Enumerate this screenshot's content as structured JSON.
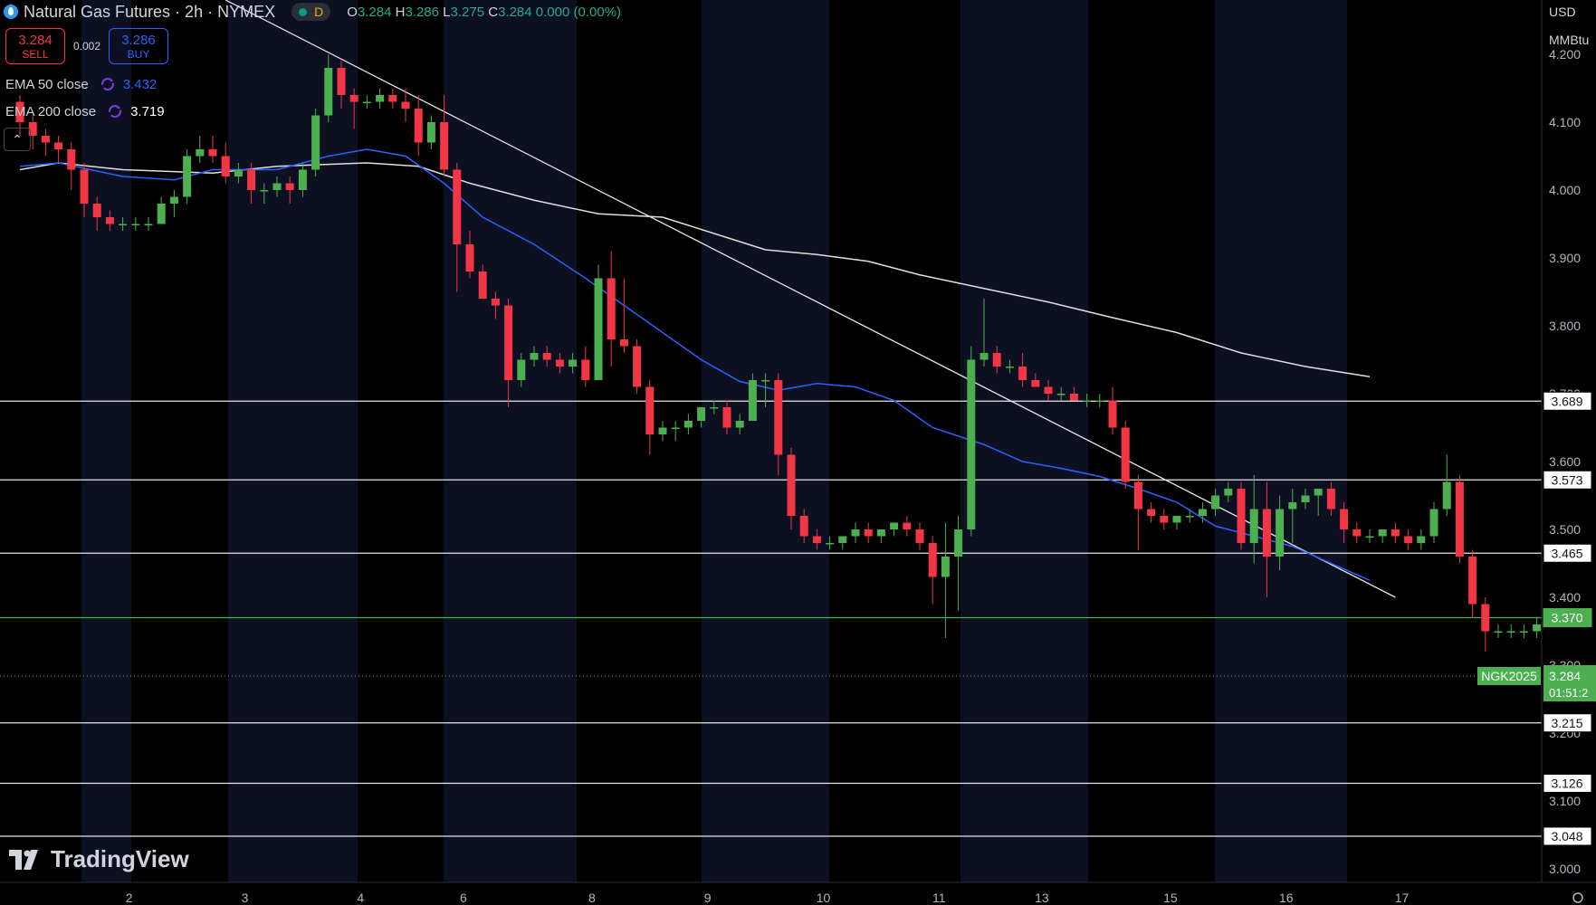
{
  "header": {
    "title": "Natural Gas Futures · 2h · NYMEX",
    "status_badge": "D",
    "ohlc": [
      {
        "label": "O",
        "value": "3.284"
      },
      {
        "label": "H",
        "value": "3.286"
      },
      {
        "label": "L",
        "value": "3.275"
      },
      {
        "label": "C",
        "value": "3.284"
      }
    ],
    "change": "0.000 (0.00%)"
  },
  "trade": {
    "sell_price": "3.284",
    "sell_label": "SELL",
    "spread": "0.002",
    "buy_price": "3.286",
    "buy_label": "BUY"
  },
  "indicators": [
    {
      "label": "EMA 50 close",
      "value": "3.432",
      "color": "#2962ff"
    },
    {
      "label": "EMA 200 close",
      "value": "3.719",
      "color": "#ffffff"
    }
  ],
  "collapse_icon": "chevron-up-icon",
  "logo": "TradingView",
  "axis_units": {
    "currency": "USD",
    "unit": "MMBtu"
  },
  "colors": {
    "up": "#4caf50",
    "down": "#f23645",
    "ema50": "#2962ff",
    "ema200": "#e0e0e0",
    "background": "#000000",
    "session": "#0c1020"
  },
  "chart_data": {
    "type": "candlestick",
    "symbol_tag": "NGK2025",
    "countdown": "01:51:2",
    "last_price": 3.284,
    "ylim": [
      2.98,
      4.28
    ],
    "y_ticks": [
      "4.200",
      "4.100",
      "4.000",
      "3.900",
      "3.800",
      "3.700",
      "3.600",
      "3.500",
      "3.400",
      "3.300",
      "3.200",
      "3.100",
      "3.000"
    ],
    "x_ticks": [
      {
        "label": "2",
        "bar": 8.5
      },
      {
        "label": "3",
        "bar": 17.5
      },
      {
        "label": "4",
        "bar": 26.5
      },
      {
        "label": "6",
        "bar": 34.5
      },
      {
        "label": "8",
        "bar": 44.5
      },
      {
        "label": "9",
        "bar": 53.5
      },
      {
        "label": "10",
        "bar": 62.5
      },
      {
        "label": "11",
        "bar": 71.5
      },
      {
        "label": "13",
        "bar": 79.5
      },
      {
        "label": "15",
        "bar": 89.5
      },
      {
        "label": "16",
        "bar": 98.5
      },
      {
        "label": "17",
        "bar": 107.5
      }
    ],
    "horizontal_levels": [
      {
        "value": 3.689,
        "label": "3.689",
        "style": "white"
      },
      {
        "value": 3.573,
        "label": "3.573",
        "style": "white"
      },
      {
        "value": 3.465,
        "label": "3.465",
        "style": "white"
      },
      {
        "value": 3.37,
        "label": "3.370",
        "style": "green"
      },
      {
        "value": 3.215,
        "label": "3.215",
        "style": "white"
      },
      {
        "value": 3.126,
        "label": "3.126",
        "style": "white"
      },
      {
        "value": 3.048,
        "label": "3.048",
        "style": "white"
      }
    ],
    "trendline": {
      "from": {
        "bar": 16,
        "price": 4.28
      },
      "to": {
        "bar": 107,
        "price": 3.4
      }
    },
    "ema200_points": [
      [
        0,
        4.03
      ],
      [
        3,
        4.04
      ],
      [
        8,
        4.03
      ],
      [
        15,
        4.025
      ],
      [
        20,
        4.035
      ],
      [
        27,
        4.04
      ],
      [
        31,
        4.035
      ],
      [
        35,
        4.01
      ],
      [
        40,
        3.985
      ],
      [
        45,
        3.965
      ],
      [
        50,
        3.96
      ],
      [
        55,
        3.93
      ],
      [
        58,
        3.912
      ],
      [
        62,
        3.905
      ],
      [
        66,
        3.895
      ],
      [
        70,
        3.875
      ],
      [
        75,
        3.855
      ],
      [
        80,
        3.835
      ],
      [
        85,
        3.812
      ],
      [
        90,
        3.79
      ],
      [
        95,
        3.76
      ],
      [
        100,
        3.74
      ],
      [
        105,
        3.725
      ]
    ],
    "ema50_points": [
      [
        0,
        4.035
      ],
      [
        3,
        4.04
      ],
      [
        8,
        4.02
      ],
      [
        12,
        4.015
      ],
      [
        15,
        4.03
      ],
      [
        20,
        4.03
      ],
      [
        24,
        4.05
      ],
      [
        27,
        4.06
      ],
      [
        30,
        4.05
      ],
      [
        33,
        4.01
      ],
      [
        36,
        3.96
      ],
      [
        40,
        3.92
      ],
      [
        44,
        3.87
      ],
      [
        47,
        3.83
      ],
      [
        50,
        3.79
      ],
      [
        53,
        3.75
      ],
      [
        56,
        3.718
      ],
      [
        59,
        3.705
      ],
      [
        62,
        3.715
      ],
      [
        65,
        3.71
      ],
      [
        68,
        3.69
      ],
      [
        71,
        3.65
      ],
      [
        75,
        3.625
      ],
      [
        78,
        3.6
      ],
      [
        81,
        3.59
      ],
      [
        84,
        3.578
      ],
      [
        87,
        3.56
      ],
      [
        90,
        3.54
      ],
      [
        93,
        3.505
      ],
      [
        96,
        3.49
      ],
      [
        99,
        3.475
      ],
      [
        102,
        3.45
      ],
      [
        105,
        3.425
      ]
    ],
    "candles": [
      [
        4.13,
        4.14,
        4.08,
        4.1
      ],
      [
        4.1,
        4.11,
        4.06,
        4.08
      ],
      [
        4.08,
        4.09,
        4.05,
        4.07
      ],
      [
        4.07,
        4.08,
        4.04,
        4.06
      ],
      [
        4.06,
        4.07,
        4.0,
        4.03
      ],
      [
        4.03,
        4.04,
        3.96,
        3.98
      ],
      [
        3.98,
        3.99,
        3.94,
        3.96
      ],
      [
        3.96,
        3.97,
        3.94,
        3.95
      ],
      [
        3.95,
        3.96,
        3.94,
        3.95
      ],
      [
        3.95,
        3.96,
        3.94,
        3.95
      ],
      [
        3.95,
        3.96,
        3.94,
        3.95
      ],
      [
        3.95,
        3.99,
        3.95,
        3.98
      ],
      [
        3.98,
        4.0,
        3.96,
        3.99
      ],
      [
        3.99,
        4.06,
        3.98,
        4.05
      ],
      [
        4.05,
        4.08,
        4.04,
        4.06
      ],
      [
        4.06,
        4.08,
        4.04,
        4.05
      ],
      [
        4.05,
        4.07,
        4.01,
        4.02
      ],
      [
        4.02,
        4.04,
        4.01,
        4.03
      ],
      [
        4.03,
        4.04,
        3.98,
        4.0
      ],
      [
        4.0,
        4.01,
        3.98,
        4.0
      ],
      [
        4.0,
        4.02,
        3.99,
        4.01
      ],
      [
        4.01,
        4.02,
        3.98,
        4.0
      ],
      [
        4.0,
        4.04,
        3.99,
        4.03
      ],
      [
        4.03,
        4.12,
        4.02,
        4.11
      ],
      [
        4.11,
        4.2,
        4.1,
        4.18
      ],
      [
        4.18,
        4.19,
        4.12,
        4.14
      ],
      [
        4.14,
        4.15,
        4.09,
        4.13
      ],
      [
        4.13,
        4.14,
        4.12,
        4.13
      ],
      [
        4.13,
        4.15,
        4.12,
        4.14
      ],
      [
        4.14,
        4.15,
        4.12,
        4.13
      ],
      [
        4.13,
        4.15,
        4.1,
        4.12
      ],
      [
        4.12,
        4.14,
        4.05,
        4.07
      ],
      [
        4.07,
        4.11,
        4.06,
        4.1
      ],
      [
        4.1,
        4.14,
        4.02,
        4.03
      ],
      [
        4.03,
        4.04,
        3.85,
        3.92
      ],
      [
        3.92,
        3.94,
        3.87,
        3.88
      ],
      [
        3.88,
        3.89,
        3.84,
        3.84
      ],
      [
        3.84,
        3.85,
        3.81,
        3.83
      ],
      [
        3.83,
        3.84,
        3.68,
        3.72
      ],
      [
        3.72,
        3.76,
        3.71,
        3.75
      ],
      [
        3.75,
        3.77,
        3.74,
        3.76
      ],
      [
        3.76,
        3.77,
        3.74,
        3.75
      ],
      [
        3.75,
        3.76,
        3.73,
        3.74
      ],
      [
        3.74,
        3.76,
        3.73,
        3.75
      ],
      [
        3.75,
        3.77,
        3.71,
        3.72
      ],
      [
        3.72,
        3.89,
        3.72,
        3.87
      ],
      [
        3.87,
        3.91,
        3.74,
        3.78
      ],
      [
        3.78,
        3.87,
        3.76,
        3.77
      ],
      [
        3.77,
        3.78,
        3.7,
        3.71
      ],
      [
        3.71,
        3.72,
        3.61,
        3.64
      ],
      [
        3.64,
        3.66,
        3.63,
        3.65
      ],
      [
        3.65,
        3.66,
        3.63,
        3.65
      ],
      [
        3.65,
        3.67,
        3.64,
        3.66
      ],
      [
        3.66,
        3.68,
        3.65,
        3.68
      ],
      [
        3.68,
        3.69,
        3.67,
        3.68
      ],
      [
        3.68,
        3.69,
        3.64,
        3.65
      ],
      [
        3.65,
        3.67,
        3.64,
        3.66
      ],
      [
        3.66,
        3.73,
        3.66,
        3.72
      ],
      [
        3.72,
        3.73,
        3.68,
        3.72
      ],
      [
        3.72,
        3.73,
        3.58,
        3.61
      ],
      [
        3.61,
        3.62,
        3.5,
        3.52
      ],
      [
        3.52,
        3.53,
        3.48,
        3.49
      ],
      [
        3.49,
        3.5,
        3.47,
        3.48
      ],
      [
        3.48,
        3.49,
        3.47,
        3.48
      ],
      [
        3.48,
        3.49,
        3.47,
        3.49
      ],
      [
        3.49,
        3.51,
        3.48,
        3.5
      ],
      [
        3.5,
        3.51,
        3.48,
        3.49
      ],
      [
        3.49,
        3.5,
        3.48,
        3.5
      ],
      [
        3.5,
        3.51,
        3.49,
        3.51
      ],
      [
        3.51,
        3.52,
        3.49,
        3.5
      ],
      [
        3.5,
        3.51,
        3.47,
        3.48
      ],
      [
        3.48,
        3.49,
        3.39,
        3.43
      ],
      [
        3.43,
        3.51,
        3.34,
        3.46
      ],
      [
        3.46,
        3.52,
        3.38,
        3.5
      ],
      [
        3.5,
        3.77,
        3.49,
        3.75
      ],
      [
        3.75,
        3.84,
        3.74,
        3.76
      ],
      [
        3.76,
        3.77,
        3.73,
        3.74
      ],
      [
        3.74,
        3.75,
        3.73,
        3.74
      ],
      [
        3.74,
        3.76,
        3.71,
        3.72
      ],
      [
        3.72,
        3.73,
        3.71,
        3.71
      ],
      [
        3.71,
        3.72,
        3.69,
        3.7
      ],
      [
        3.7,
        3.71,
        3.69,
        3.7
      ],
      [
        3.7,
        3.71,
        3.69,
        3.69
      ],
      [
        3.69,
        3.7,
        3.68,
        3.69
      ],
      [
        3.69,
        3.7,
        3.68,
        3.69
      ],
      [
        3.69,
        3.71,
        3.64,
        3.65
      ],
      [
        3.65,
        3.66,
        3.56,
        3.57
      ],
      [
        3.57,
        3.58,
        3.47,
        3.53
      ],
      [
        3.53,
        3.54,
        3.51,
        3.52
      ],
      [
        3.52,
        3.53,
        3.5,
        3.51
      ],
      [
        3.51,
        3.52,
        3.5,
        3.52
      ],
      [
        3.52,
        3.53,
        3.51,
        3.52
      ],
      [
        3.52,
        3.54,
        3.51,
        3.53
      ],
      [
        3.53,
        3.56,
        3.52,
        3.55
      ],
      [
        3.55,
        3.57,
        3.54,
        3.56
      ],
      [
        3.56,
        3.57,
        3.47,
        3.48
      ],
      [
        3.48,
        3.58,
        3.45,
        3.53
      ],
      [
        3.53,
        3.57,
        3.4,
        3.46
      ],
      [
        3.46,
        3.55,
        3.44,
        3.53
      ],
      [
        3.53,
        3.56,
        3.48,
        3.54
      ]
    ],
    "candles_tail": [
      [
        3.54,
        3.56,
        3.53,
        3.55
      ],
      [
        3.55,
        3.56,
        3.52,
        3.56
      ],
      [
        3.56,
        3.57,
        3.52,
        3.53
      ],
      [
        3.53,
        3.54,
        3.48,
        3.5
      ],
      [
        3.5,
        3.51,
        3.48,
        3.49
      ],
      [
        3.49,
        3.5,
        3.48,
        3.49
      ],
      [
        3.49,
        3.5,
        3.48,
        3.5
      ],
      [
        3.5,
        3.51,
        3.48,
        3.49
      ],
      [
        3.49,
        3.5,
        3.47,
        3.48
      ],
      [
        3.48,
        3.5,
        3.47,
        3.49
      ],
      [
        3.49,
        3.54,
        3.48,
        3.53
      ],
      [
        3.53,
        3.61,
        3.52,
        3.57
      ],
      [
        3.57,
        3.58,
        3.45,
        3.46
      ],
      [
        3.46,
        3.47,
        3.37,
        3.39
      ],
      [
        3.39,
        3.4,
        3.32,
        3.35
      ],
      [
        3.35,
        3.36,
        3.34,
        3.35
      ],
      [
        3.35,
        3.36,
        3.34,
        3.35
      ],
      [
        3.35,
        3.36,
        3.34,
        3.35
      ],
      [
        3.35,
        3.37,
        3.34,
        3.36
      ],
      [
        3.36,
        3.37,
        3.35,
        3.37
      ],
      [
        3.37,
        3.38,
        3.35,
        3.36
      ],
      [
        3.36,
        3.37,
        3.34,
        3.35
      ],
      [
        3.35,
        3.37,
        3.26,
        3.27
      ],
      [
        3.27,
        3.28,
        3.22,
        3.28
      ],
      [
        3.28,
        3.32,
        3.27,
        3.28
      ],
      [
        3.28,
        3.34,
        3.28,
        3.33
      ],
      [
        3.33,
        3.35,
        3.31,
        3.32
      ],
      [
        3.32,
        3.33,
        3.31,
        3.32
      ],
      [
        3.32,
        3.33,
        3.3,
        3.31
      ],
      [
        3.31,
        3.32,
        3.29,
        3.3
      ],
      [
        3.3,
        3.31,
        3.29,
        3.29
      ],
      [
        3.29,
        3.3,
        3.28,
        3.29
      ],
      [
        3.29,
        3.29,
        3.28,
        3.28
      ]
    ]
  }
}
